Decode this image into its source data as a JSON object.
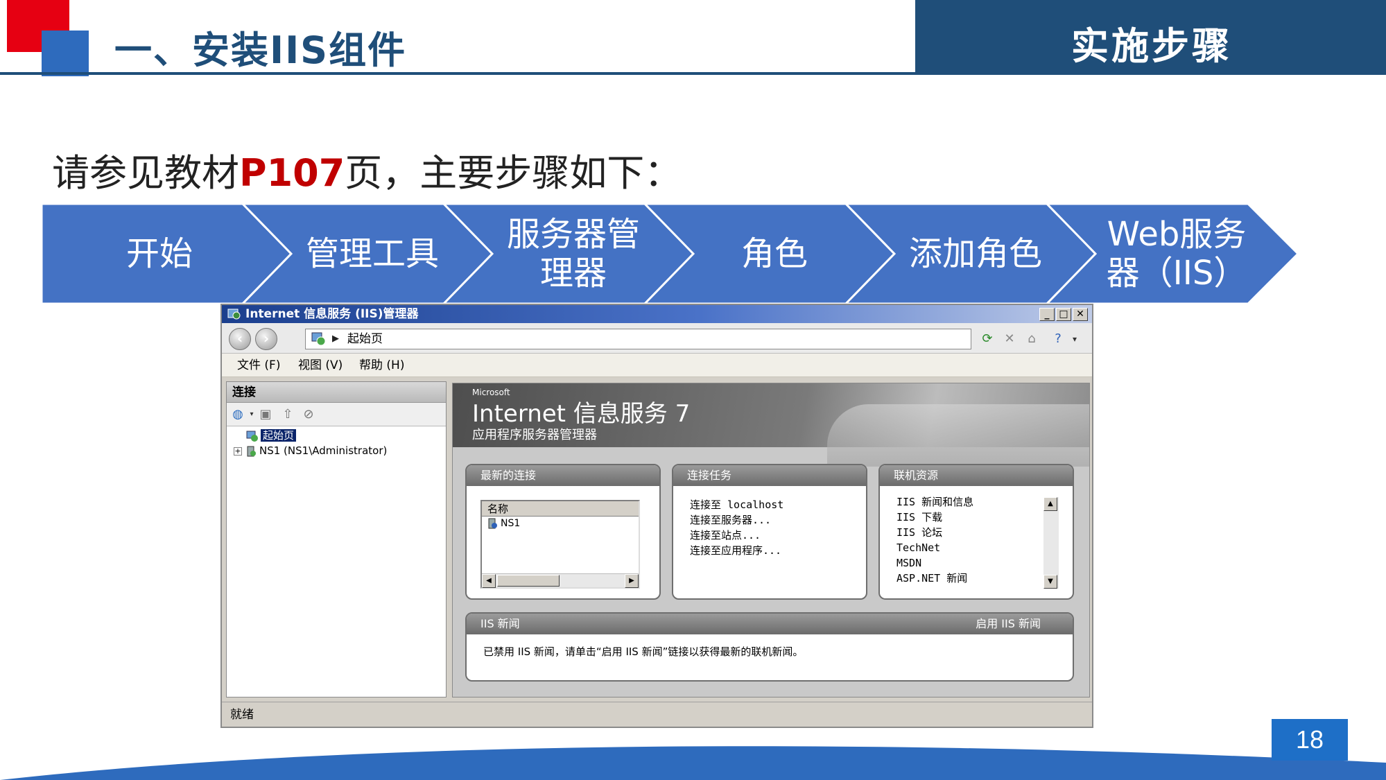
{
  "slide": {
    "title": "一、安装IIS组件",
    "header_label": "实施步骤",
    "intro_prefix": "请参见教材",
    "intro_highlight": "P107",
    "intro_suffix": "页，主要步骤如下：",
    "page_number": "18"
  },
  "process_steps": [
    {
      "label": "开始"
    },
    {
      "label": "管理工具"
    },
    {
      "label": "服务器管\n理器"
    },
    {
      "label": "角色"
    },
    {
      "label": "添加角色"
    },
    {
      "label": "Web服务\n器（IIS）"
    }
  ],
  "colors": {
    "arrow_fill": "#4472c4",
    "title_blue": "#1f4e79",
    "accent_red": "#c00000"
  },
  "window": {
    "title": "Internet 信息服务 (IIS)管理器",
    "address_text": "起始页",
    "menu": [
      "文件 (F)",
      "视图 (V)",
      "帮助 (H)"
    ],
    "connections_header": "连接",
    "tree": [
      {
        "label": "起始页",
        "selected": true
      },
      {
        "label": "NS1  (NS1\\Administrator)",
        "selected": false
      }
    ],
    "status": "就绪",
    "banner": {
      "vendor": "Microsoft",
      "title": "Internet 信息服务 7",
      "subtitle": "应用程序服务器管理器"
    },
    "recent_connections": {
      "header": "最新的连接",
      "column": "名称",
      "rows": [
        "NS1"
      ]
    },
    "connection_tasks": {
      "header": "连接任务",
      "items": [
        "连接至 localhost",
        "连接至服务器...",
        "连接至站点...",
        "连接至应用程序..."
      ]
    },
    "online_resources": {
      "header": "联机资源",
      "items": [
        "IIS 新闻和信息",
        "IIS 下载",
        "IIS 论坛",
        "TechNet",
        "MSDN",
        "ASP.NET 新闻"
      ]
    },
    "iis_news": {
      "header": "IIS 新闻",
      "enable_link": "启用 IIS 新闻",
      "message": "已禁用 IIS 新闻，请单击“启用 IIS 新闻”链接以获得最新的联机新闻。"
    }
  }
}
